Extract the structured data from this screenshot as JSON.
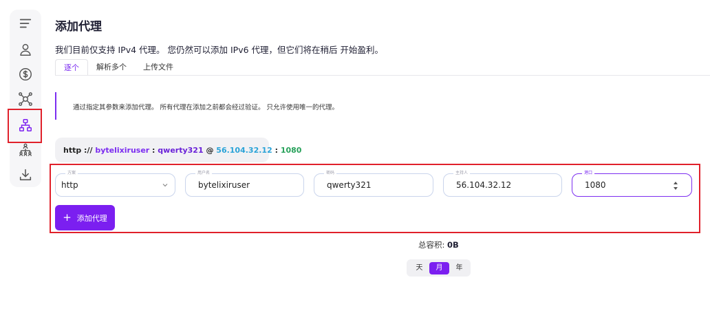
{
  "sidebar": {
    "items": [
      {
        "icon": "menu-icon"
      },
      {
        "icon": "user-icon"
      },
      {
        "icon": "dollar-icon"
      },
      {
        "icon": "network-hub-icon"
      },
      {
        "icon": "sitemap-icon",
        "active": true
      },
      {
        "icon": "people-hierarchy-icon"
      },
      {
        "icon": "download-icon"
      }
    ]
  },
  "header": {
    "title": "添加代理",
    "subtitle": "我们目前仅支持 IPv4 代理。 您仍然可以添加 IPv6 代理，但它们将在稍后 开始盈利。"
  },
  "tabs": [
    {
      "label": "逐个",
      "active": true
    },
    {
      "label": "解析多个",
      "active": false
    },
    {
      "label": "上传文件",
      "active": false
    }
  ],
  "info": {
    "text": "通过指定其参数来添加代理。 所有代理在添加之前都会经过验证。 只允许使用唯一的代理。"
  },
  "preview": {
    "protocol": "http ://",
    "username": "bytelixiruser",
    "sep1": ":",
    "password": "qwerty321",
    "at": "@",
    "host": "56.104.32.12",
    "sep2": ":",
    "port": "1080"
  },
  "form": {
    "protocol": {
      "label": "方案",
      "value": "http"
    },
    "username": {
      "label": "用户名",
      "value": "bytelixiruser"
    },
    "password": {
      "label": "密码",
      "value": "qwerty321"
    },
    "host": {
      "label": "主持人",
      "value": "56.104.32.12"
    },
    "port": {
      "label": "港口",
      "value": "1080"
    },
    "add_button": "添加代理"
  },
  "capacity": {
    "label": "总容积:",
    "value": "0B"
  },
  "period": [
    {
      "label": "天",
      "active": false
    },
    {
      "label": "月",
      "active": true
    },
    {
      "label": "年",
      "active": false
    }
  ],
  "colors": {
    "accent": "#7b1ff0",
    "highlight": "#e0202a"
  }
}
